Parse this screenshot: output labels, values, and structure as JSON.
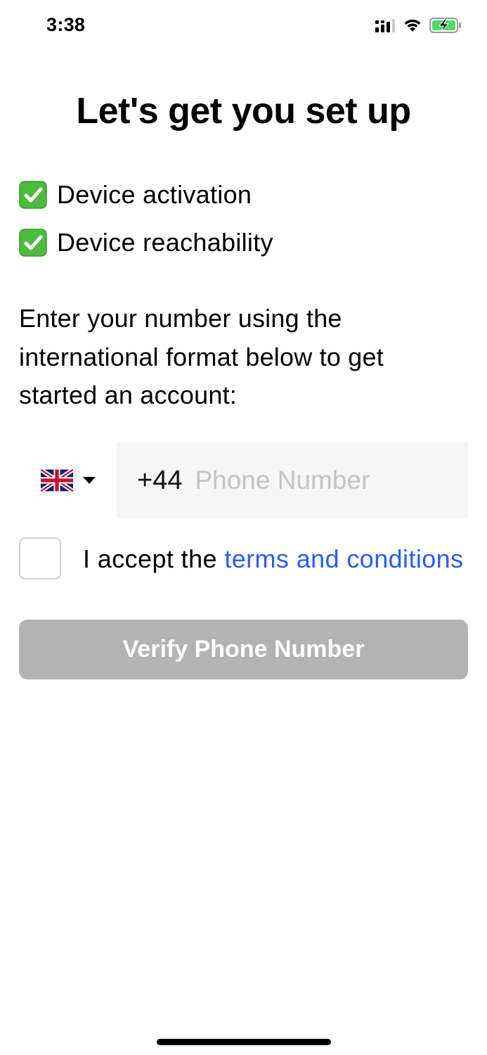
{
  "status_bar": {
    "time": "3:38",
    "icons": [
      "cellular-signal-icon",
      "wifi-icon",
      "battery-charging-icon"
    ],
    "battery_color": "#4cd964"
  },
  "title": "Let's get you set up",
  "checklist": [
    {
      "icon": "checkmark-box-icon",
      "label": "Device activation"
    },
    {
      "icon": "checkmark-box-icon",
      "label": "Device reachability"
    }
  ],
  "instructions": "Enter your number using the international format below to get started an account:",
  "phone": {
    "country_flag": "uk-flag-icon",
    "dial_code": "+44",
    "value": "",
    "placeholder": "Phone Number"
  },
  "terms": {
    "checked": false,
    "prefix": "I accept the ",
    "link_label": "terms and conditions"
  },
  "verify_button": {
    "label": "Verify Phone Number",
    "enabled": false
  },
  "colors": {
    "link": "#2b5cf0",
    "button_disabled": "#b3b3b3",
    "input_background": "#f5f6f5",
    "check_green": "#4cbb3c"
  }
}
